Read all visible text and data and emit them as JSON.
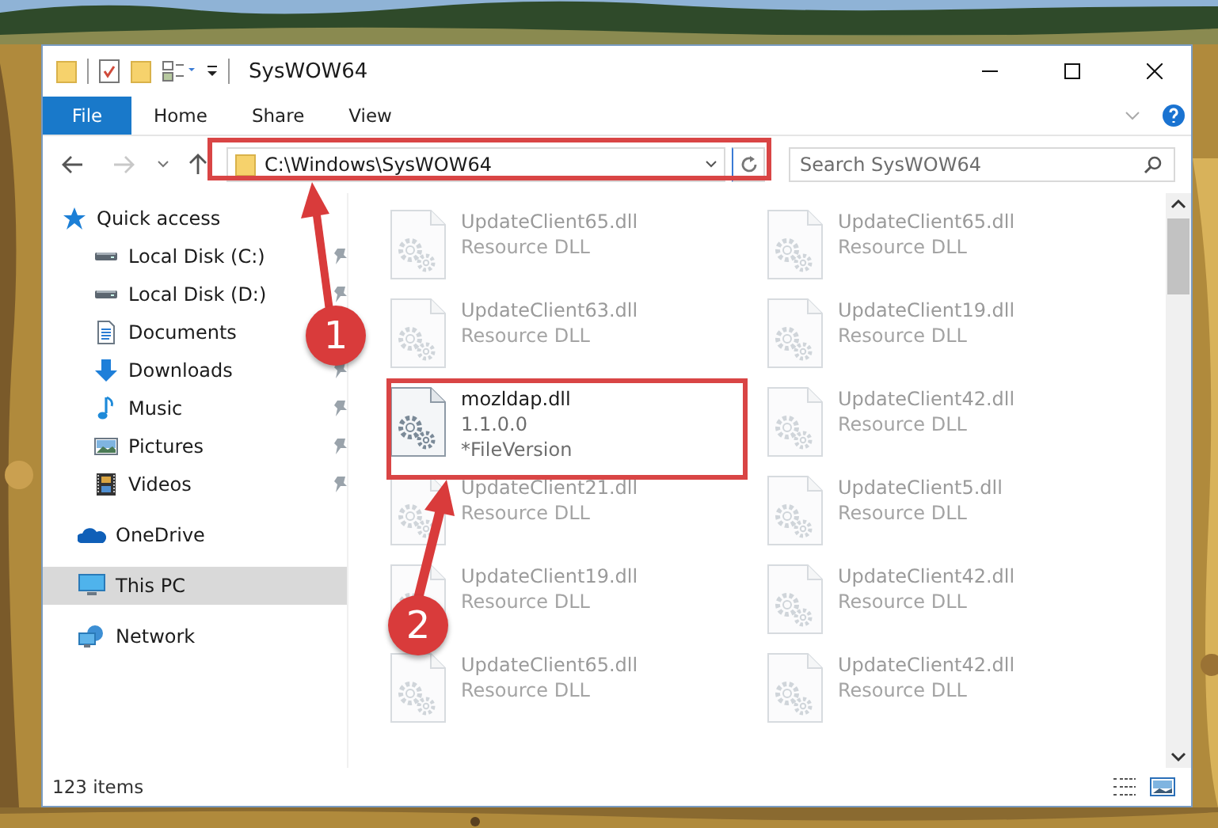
{
  "window": {
    "title": "SysWOW64"
  },
  "ribbon_tabs": [
    {
      "label": "File",
      "kind": "menu"
    },
    {
      "label": "Home",
      "kind": "tab"
    },
    {
      "label": "Share",
      "kind": "tab"
    },
    {
      "label": "View",
      "kind": "tab"
    }
  ],
  "address": {
    "path": "C:\\Windows\\SysWOW64"
  },
  "search": {
    "placeholder": "Search SysWOW64"
  },
  "sidebar": {
    "items": [
      {
        "label": "Quick access",
        "kind": "star",
        "selected": false,
        "children": [
          {
            "label": "Local Disk (C:)",
            "kind": "disk",
            "pinned": true,
            "selected": false
          },
          {
            "label": "Local Disk (D:)",
            "kind": "disk",
            "pinned": true,
            "selected": false
          },
          {
            "label": "Documents",
            "kind": "document",
            "selected": false
          },
          {
            "label": "Downloads",
            "kind": "download",
            "pinned": true,
            "selected": false
          },
          {
            "label": "Music",
            "kind": "music",
            "pinned": true,
            "selected": false
          },
          {
            "label": "Pictures",
            "kind": "pictures",
            "pinned": true,
            "selected": false
          },
          {
            "label": "Videos",
            "kind": "videos",
            "pinned": true,
            "selected": false
          }
        ]
      },
      {
        "label": "OneDrive",
        "kind": "cloud",
        "selected": false
      },
      {
        "label": "This PC",
        "kind": "pc",
        "selected": true
      },
      {
        "label": "Network",
        "kind": "network",
        "selected": false
      }
    ]
  },
  "files": [
    {
      "name": "UpdateClient65.dll",
      "lines": [
        "Resource DLL"
      ],
      "faded": true
    },
    {
      "name": "UpdateClient65.dll",
      "lines": [
        "Resource DLL"
      ],
      "faded": true
    },
    {
      "name": "UpdateClient63.dll",
      "lines": [
        "Resource DLL"
      ],
      "faded": true
    },
    {
      "name": "UpdateClient19.dll",
      "lines": [
        "Resource DLL"
      ],
      "faded": true
    },
    {
      "name": "mozldap.dll",
      "lines": [
        "1.1.0.0",
        "*FileVersion"
      ],
      "faded": false
    },
    {
      "name": "UpdateClient42.dll",
      "lines": [
        "Resource DLL"
      ],
      "faded": true
    },
    {
      "name": "UpdateClient21.dll",
      "lines": [
        "Resource DLL"
      ],
      "faded": true
    },
    {
      "name": "UpdateClient5.dll",
      "lines": [
        "Resource DLL"
      ],
      "faded": true
    },
    {
      "name": "UpdateClient19.dll",
      "lines": [
        "Resource DLL"
      ],
      "faded": true
    },
    {
      "name": "UpdateClient42.dll",
      "lines": [
        "Resource DLL"
      ],
      "faded": true
    },
    {
      "name": "UpdateClient65.dll",
      "lines": [
        "Resource DLL"
      ],
      "faded": true
    },
    {
      "name": "UpdateClient42.dll",
      "lines": [
        "Resource DLL"
      ],
      "faded": true
    }
  ],
  "status_bar": {
    "count": "123 items"
  },
  "annotations": [
    {
      "number": "1"
    },
    {
      "number": "2"
    }
  ]
}
